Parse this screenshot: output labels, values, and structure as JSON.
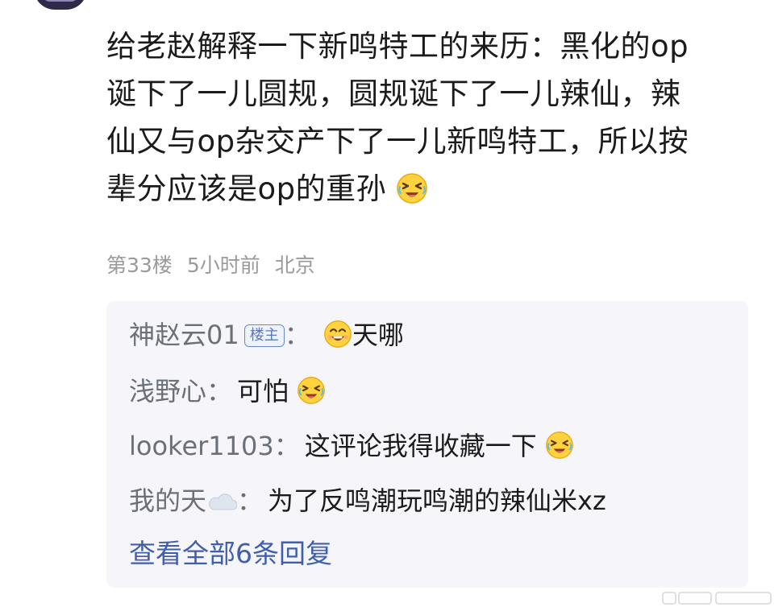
{
  "comment": {
    "text_lines": [
      "给老赵解释一下新鸣特工的来历：黑化的op",
      "诞下了一儿圆规，圆规诞下了一儿辣仙，辣",
      "仙又与op杂交产下了一儿新鸣特工，所以按",
      "辈分应该是op的重孙"
    ],
    "emoji": "laughing-face-emoji"
  },
  "meta": {
    "floor": "第33楼",
    "time": "5小时前",
    "location": "北京"
  },
  "replies": [
    {
      "author": "神赵云01",
      "badge": "楼主",
      "colon": "：",
      "emoji_before": "grinning-face-emoji",
      "text": "天哪"
    },
    {
      "author": "浅野心",
      "colon": "：",
      "text": "可怕",
      "emoji_after": "laughing-face-emoji"
    },
    {
      "author": "looker1103",
      "colon": "：",
      "text": "这评论我得收藏一下",
      "emoji_after": "laughing-face-emoji"
    },
    {
      "author": "我的天",
      "author_icon": "cloud-icon",
      "colon": "：",
      "text": "为了反鸣潮玩鸣潮的辣仙米xz"
    }
  ],
  "view_all_label": "查看全部6条回复",
  "colors": {
    "text": "#1b1b1b",
    "author": "#6b6f78",
    "meta": "#9a9a9a",
    "link": "#3f5fae",
    "reply_bg": "#f6f6fa",
    "badge": "#5877c2"
  }
}
